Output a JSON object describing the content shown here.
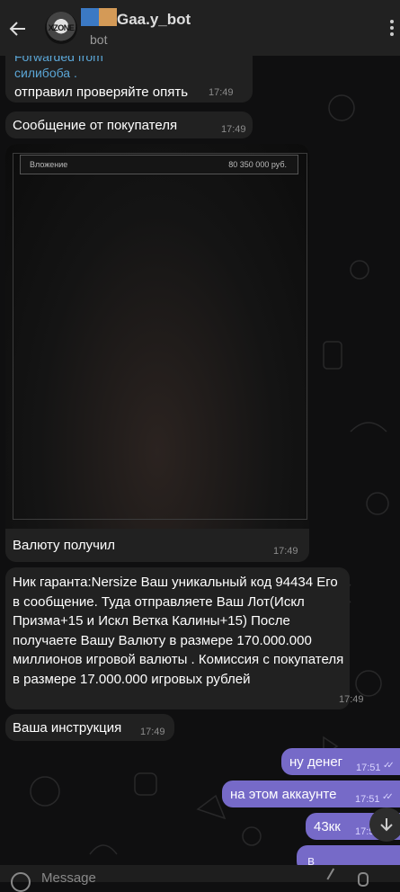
{
  "header": {
    "title": "Gaa.y_bot",
    "subtitle": "bot",
    "avatar_text": "XZONE",
    "title_colors": [
      "#3b79c4",
      "#d49a57"
    ]
  },
  "messages": {
    "forwarded_label": "Forwarded from",
    "forwarded_name": "силибоба .",
    "m1_text": "отправил проверяйте опять",
    "m1_time": "17:49",
    "m2_text": "Сообщение от покупателя",
    "m2_time": "17:49",
    "attach_label": "Вложение",
    "attach_amount": "80 350 000 руб.",
    "m3_text": "Валюту получил",
    "m3_time": "17:49",
    "m4_text": "Ник гаранта:Nersize Ваш уникальный код 94434 Его в сообщение. Туда отправляете Ваш Лот(Искл Призма+15 и Искл Ветка Калины+15)  После получаете Вашу Валюту в размере  170.000.000 миллионов игровой валюты . Комиссия с покупателя в размере 17.000.000 игровых рублей",
    "m4_time": "17:49",
    "m5_text": "Ваша инструкция",
    "m5_time": "17:49",
    "o1_text": "ну денег",
    "o1_time": "17:51",
    "o2_text": "на этом аккаунте",
    "o2_time": "17:51",
    "o3_text": "43кк",
    "o3_time": "17:51",
    "o4_text": "в"
  },
  "composer": {
    "placeholder": "Message"
  },
  "colors": {
    "outgoing": "#766ac8",
    "incoming": "#212121",
    "link": "#5ba6d6"
  }
}
